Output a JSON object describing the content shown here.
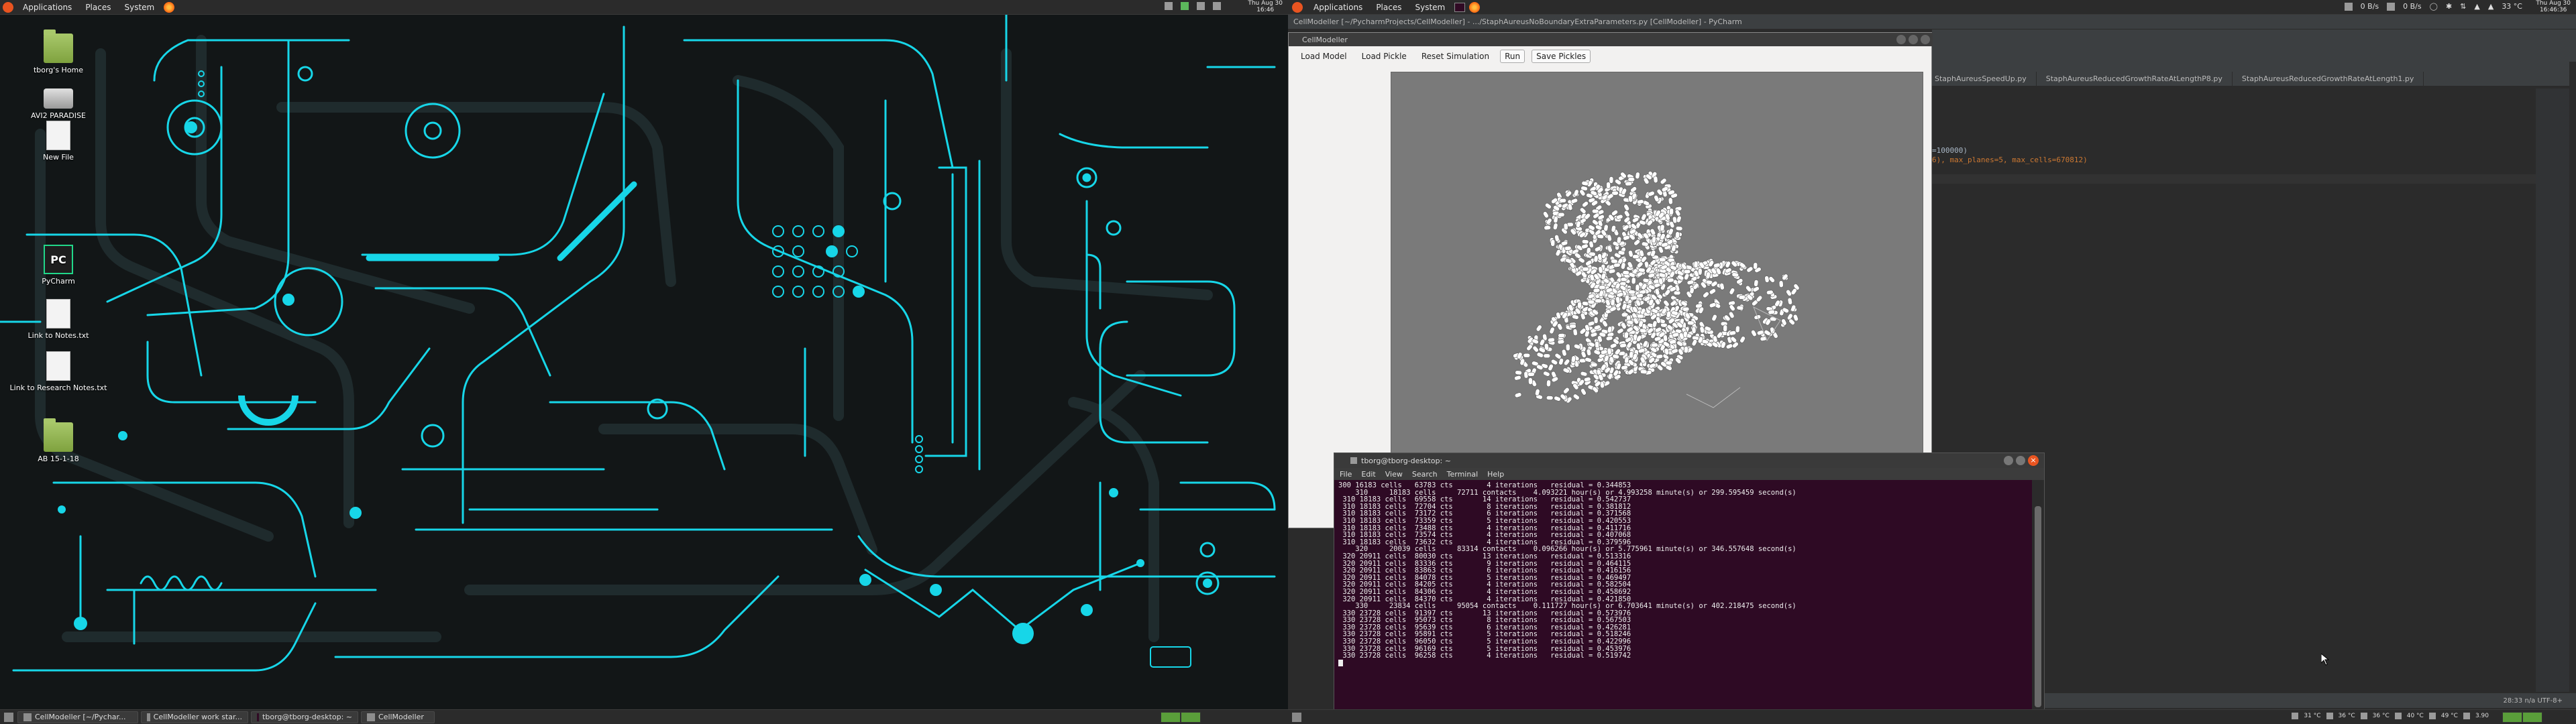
{
  "left_panel": {
    "menus": [
      "Applications",
      "Places",
      "System"
    ],
    "clock": "Thu Aug 30\n16:46"
  },
  "desktop_icons": [
    {
      "label": "tborg's Home",
      "kind": "folder"
    },
    {
      "label": "AVI2 PARADISE",
      "kind": "drive"
    },
    {
      "label": "New File",
      "kind": "file"
    },
    {
      "label": "PyCharm",
      "kind": "app"
    },
    {
      "label": "Link to Notes.txt",
      "kind": "file"
    },
    {
      "label": "Link to Research Notes.txt",
      "kind": "file"
    },
    {
      "label": "AB 15-1-18",
      "kind": "folder"
    }
  ],
  "taskbar_left": [
    "CellModeller [~/Pychar...",
    "CellModeller work star...",
    "tborg@tborg-desktop: ~",
    "CellModeller"
  ],
  "right_panel": {
    "menus": [
      "Applications",
      "Places",
      "System"
    ],
    "net_down": "0 B/s",
    "net_up": "0 B/s",
    "temp": "33 °C",
    "clock": "Thu Aug 30\n16:46:36"
  },
  "pycharm": {
    "title": "CellModeller [~/PycharmProjects/CellModeller] - .../StaphAureusNoBoundaryExtraParameters.py [CellModeller] - PyCharm",
    "tabs": [
      "StaphAureusSpeedUp.py",
      "StaphAureusReducedGrowthRateAtLengthP8.py",
      "StaphAureusReducedGrowthRateAtLength1.py"
    ],
    "code_line1": "=100000)",
    "code_line2": "6), max_planes=5, max_cells=670812)",
    "status_right": "28:33   n/a   UTF-8+"
  },
  "cm_window": {
    "title": "CellModeller",
    "toolbar": {
      "load_model": "Load Model",
      "load_pickle": "Load Pickle",
      "reset_simulation": "Reset Simulation",
      "run": "Run",
      "save_pickles": "Save Pickles"
    }
  },
  "terminal": {
    "title": "tborg@tborg-desktop: ~",
    "menus": [
      "File",
      "Edit",
      "View",
      "Search",
      "Terminal",
      "Help"
    ],
    "lines": [
      "300 16183 cells   63783 cts        4 iterations   residual = 0.344853",
      "    310     18183 cells     72711 contacts    4.093221 hour(s) or 4.993258 minute(s) or 299.595459 second(s)",
      " 310 18183 cells  69558 cts       14 iterations   residual = 0.542737",
      " 310 18183 cells  72704 cts        8 iterations   residual = 0.381812",
      " 310 18183 cells  73172 cts        6 iterations   residual = 0.371568",
      " 310 18183 cells  73359 cts        5 iterations   residual = 0.420553",
      " 310 18183 cells  73488 cts        4 iterations   residual = 0.411716",
      " 310 18183 cells  73574 cts        4 iterations   residual = 0.407068",
      " 310 18183 cells  73632 cts        4 iterations   residual = 0.379596",
      "    320     20039 cells     83314 contacts    0.096266 hour(s) or 5.775961 minute(s) or 346.557648 second(s)",
      " 320 20911 cells  80030 cts       13 iterations   residual = 0.513316",
      " 320 20911 cells  83336 cts        9 iterations   residual = 0.464115",
      " 320 20911 cells  83863 cts        6 iterations   residual = 0.416156",
      " 320 20911 cells  84078 cts        5 iterations   residual = 0.469497",
      " 320 20911 cells  84205 cts        4 iterations   residual = 0.582504",
      " 320 20911 cells  84306 cts        4 iterations   residual = 0.458692",
      " 320 20911 cells  84370 cts        4 iterations   residual = 0.421850",
      "    330     23834 cells     95054 contacts    0.111727 hour(s) or 6.703641 minute(s) or 402.218475 second(s)",
      " 330 23728 cells  91397 cts       13 iterations   residual = 0.573976",
      " 330 23728 cells  95073 cts        8 iterations   residual = 0.567503",
      " 330 23728 cells  95639 cts        6 iterations   residual = 0.426281",
      " 330 23728 cells  95891 cts        5 iterations   residual = 0.518246",
      " 330 23728 cells  96050 cts        5 iterations   residual = 0.422996",
      " 330 23728 cells  96169 cts        5 iterations   residual = 0.453976",
      " 330 23728 cells  96258 cts        4 iterations   residual = 0.519742"
    ]
  },
  "bottom_right_tray": [
    "31 °C",
    "36 °C",
    "36 °C",
    "40 °C",
    "49 °C",
    "3.90"
  ],
  "colors": {
    "wallpaper_bg": "#121617",
    "circuit": "#17d6e8",
    "terminal_bg": "#2e0a24",
    "accent_orange": "#e95420"
  }
}
